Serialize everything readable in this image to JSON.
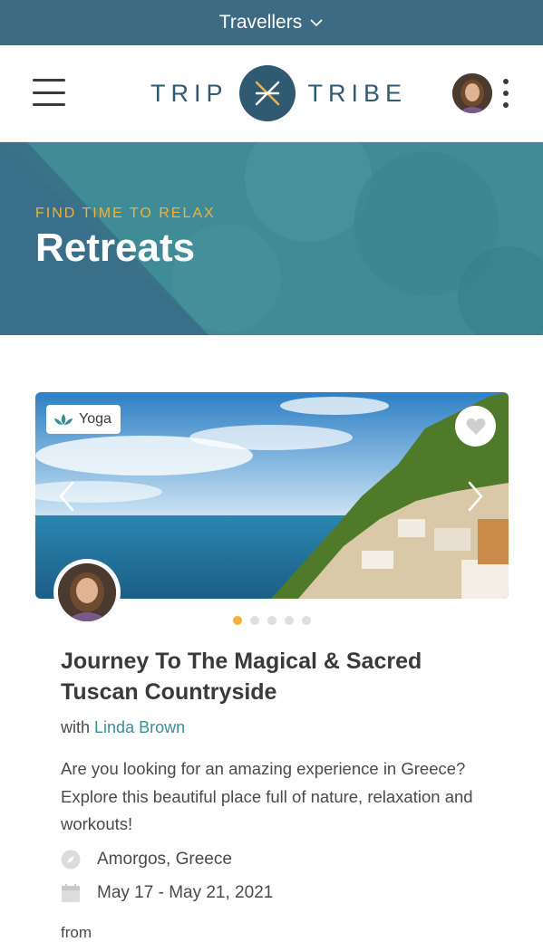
{
  "topbar": {
    "label": "Travellers"
  },
  "logo": {
    "left_word": "TRIP",
    "right_word": "TRIBE"
  },
  "hero": {
    "eyebrow": "FIND TIME TO RELAX",
    "title": "Retreats"
  },
  "card": {
    "tag": "Yoga",
    "title": "Journey To The Magical & Sacred Tuscan Countryside",
    "host_prefix": "with",
    "host_name": "Linda Brown",
    "description": "Are you looking for an amazing experience in Greece? Explore this beautiful place full of nature, relaxation and workouts!",
    "location": "Amorgos, Greece",
    "dates": "May 17 - May 21, 2021",
    "price_prefix": "from",
    "slides_total": 5,
    "active_slide": 1
  },
  "colors": {
    "topbar": "#3d6b83",
    "brand": "#2f5a72",
    "hero_teal": "#3f8c97",
    "accent_yellow": "#f2b13a",
    "link_teal": "#3a8e9a"
  },
  "icons": {
    "menu": "hamburger-icon",
    "more": "kebab-icon",
    "dropdown": "chevron-down-icon",
    "tag": "lotus-icon",
    "favorite": "heart-icon",
    "prev": "chevron-left-icon",
    "next": "chevron-right-icon",
    "location": "compass-icon",
    "date": "calendar-icon"
  }
}
